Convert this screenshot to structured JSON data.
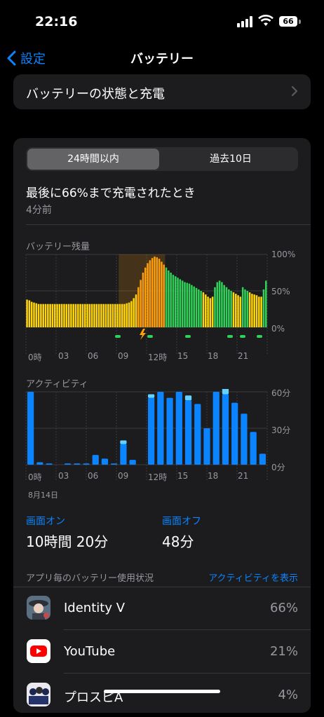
{
  "status_bar": {
    "time": "22:16",
    "battery": "66"
  },
  "nav": {
    "back_label": "設定",
    "title": "バッテリー"
  },
  "health": {
    "label": "バッテリーの状態と充電"
  },
  "segments": {
    "selected": "24時間以内",
    "other": "過去10日"
  },
  "last_charge": {
    "title": "最後に66%まで充電されたとき",
    "subtitle": "4分前"
  },
  "chart_data": [
    {
      "type": "bar",
      "title": "バッテリー残量",
      "y_ticks": [
        "100%",
        "50%",
        "0%"
      ],
      "x_ticks": [
        "0時",
        "03",
        "06",
        "09",
        "12時",
        "15",
        "18",
        "21"
      ],
      "ylim": [
        0,
        100
      ],
      "values": [
        38,
        37,
        35,
        34,
        33,
        32,
        32,
        32,
        32,
        32,
        32,
        32,
        32,
        32,
        32,
        32,
        32,
        32,
        32,
        32,
        32,
        32,
        32,
        32,
        32,
        32,
        32,
        32,
        32,
        32,
        32,
        32,
        32,
        32,
        32,
        32,
        32,
        32,
        32,
        32,
        32,
        32,
        32,
        33,
        34,
        36,
        40,
        45,
        55,
        65,
        75,
        82,
        88,
        92,
        95,
        97,
        96,
        94,
        90,
        86,
        82,
        78,
        75,
        72,
        70,
        68,
        66,
        64,
        62,
        61,
        60,
        58,
        56,
        54,
        52,
        50,
        48,
        45,
        42,
        40,
        42,
        55,
        62,
        64,
        62,
        58,
        55,
        52,
        50,
        48,
        46,
        44,
        42,
        55,
        52,
        50,
        48,
        46,
        45,
        44,
        42,
        42,
        52,
        64
      ],
      "charging_ranges": [
        [
          40,
          60
        ]
      ],
      "charging_indicator": "bolt-icon"
    },
    {
      "type": "bar",
      "title": "アクティビティ",
      "y_ticks": [
        "60分",
        "30分",
        "0分"
      ],
      "x_ticks": [
        "0時",
        "03",
        "06",
        "09",
        "12時",
        "15",
        "18",
        "21"
      ],
      "date_label": "8月14日",
      "ylim": [
        0,
        60
      ],
      "series": [
        {
          "name": "画面オン",
          "values": [
            60,
            2,
            1,
            0,
            1,
            1,
            1,
            8,
            5,
            1,
            17,
            4,
            0,
            55,
            60,
            55,
            60,
            53,
            50,
            30,
            60,
            58,
            51,
            42,
            27,
            9
          ]
        },
        {
          "name": "画面オフ",
          "values": [
            0,
            0,
            0,
            0,
            0,
            0,
            0,
            0,
            0,
            0,
            3,
            0,
            0,
            3,
            0,
            0,
            0,
            4,
            0,
            0,
            0,
            7,
            0,
            0,
            0,
            0
          ]
        }
      ]
    }
  ],
  "stats": {
    "screen_on": {
      "label": "画面オン",
      "value": "10時間 20分"
    },
    "screen_off": {
      "label": "画面オフ",
      "value": "48分"
    }
  },
  "usage_header": {
    "label": "アプリ毎のバッテリー使用状況",
    "action": "アクティビティを表示"
  },
  "apps": [
    {
      "name": "Identity V",
      "percent": "66%",
      "icon": "identity-v-icon"
    },
    {
      "name": "YouTube",
      "percent": "21%",
      "icon": "youtube-icon"
    },
    {
      "name": "プロスピA",
      "percent": "4%",
      "icon": "prospi-icon"
    }
  ],
  "colors": {
    "accent": "#0a84ff",
    "battery_green": "#30d158",
    "battery_yellow": "#ffd60a",
    "charging_orange": "#ff9f0a",
    "activity_blue": "#0a84ff",
    "activity_light": "#64d2ff"
  }
}
